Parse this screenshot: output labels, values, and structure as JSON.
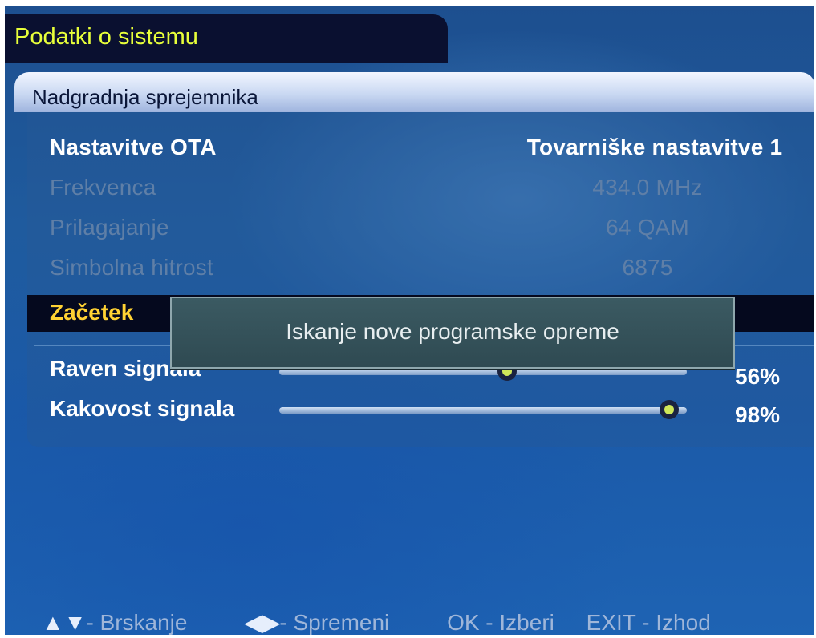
{
  "title": "Podatki o sistemu",
  "header": "Nadgradnja sprejemnika",
  "settings": [
    {
      "label": "Nastavitve OTA",
      "value": "Tovarniške nastavitve 1",
      "enabled": true
    },
    {
      "label": "Frekvenca",
      "value": "434.0 MHz",
      "enabled": false
    },
    {
      "label": "Prilagajanje",
      "value": "64 QAM",
      "enabled": false
    },
    {
      "label": "Simbolna hitrost",
      "value": "6875",
      "enabled": false
    }
  ],
  "start_label": "Začetek",
  "signal": {
    "level_label": "Raven signala",
    "level_value": "56%",
    "level_fraction": 0.56,
    "quality_label": "Kakovost signala",
    "quality_value": "98%",
    "quality_fraction": 0.98
  },
  "popup_text": "Iskanje nove programske opreme",
  "footer": {
    "nav_symbol": "▲▼",
    "nav_label": "- Brskanje",
    "change_symbol": "◀▶",
    "change_label": "- Spremeni",
    "ok_label": "OK - Izberi",
    "exit_label": "EXIT - Izhod"
  },
  "colors": {
    "title_text": "#e8ff3a",
    "start_text": "#ffd233",
    "background": "#1f5b9e"
  }
}
